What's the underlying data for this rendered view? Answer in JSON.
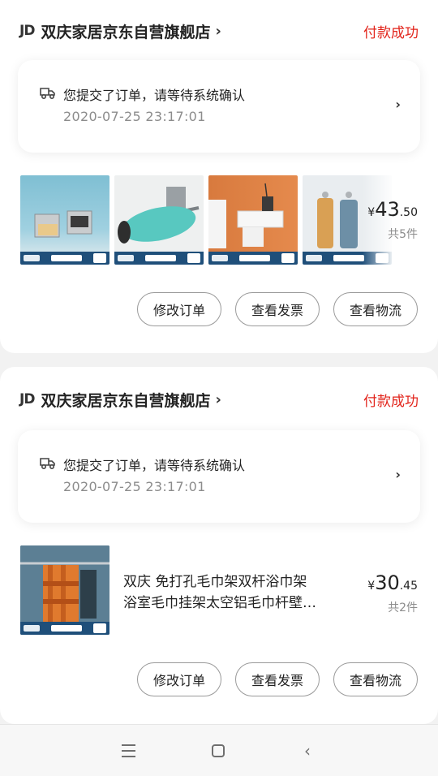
{
  "orders": [
    {
      "store": {
        "logo": "JD",
        "name": "双庆家居京东自营旗舰店",
        "arrow": "›"
      },
      "status": "付款成功",
      "notice": {
        "icon": "truck-icon",
        "title": "您提交了订单，请等待系统确认",
        "time": "2020-07-25 23:17:01",
        "chevron": "›"
      },
      "products": [
        {
          "icon": "soap-holder-image"
        },
        {
          "icon": "paper-towel-holder-image"
        },
        {
          "icon": "toilet-paper-shelf-image"
        },
        {
          "icon": "towel-hooks-image"
        }
      ],
      "price": {
        "yen": "¥",
        "int": "43",
        "dec": ".50"
      },
      "count": "共5件",
      "actions": [
        "修改订单",
        "查看发票",
        "查看物流"
      ]
    },
    {
      "store": {
        "logo": "JD",
        "name": "双庆家居京东自营旗舰店",
        "arrow": "›"
      },
      "status": "付款成功",
      "notice": {
        "icon": "truck-icon",
        "title": "您提交了订单，请等待系统确认",
        "time": "2020-07-25 23:17:01",
        "chevron": "›"
      },
      "product": {
        "icon": "towel-rack-image",
        "desc_line1": "双庆 免打孔毛巾架双杆浴巾架",
        "desc_line2": "浴室毛巾挂架太空铝毛巾杆壁…"
      },
      "price": {
        "yen": "¥",
        "int": "30",
        "dec": ".45"
      },
      "count": "共2件",
      "actions": [
        "修改订单",
        "查看发票",
        "查看物流"
      ]
    }
  ],
  "navbar": {
    "menu_icon": "menu-icon",
    "home_icon": "home-icon",
    "back_icon": "back-icon",
    "back_glyph": "‹"
  },
  "colors": {
    "status_red": "#e2231a",
    "background": "#f2f2f2",
    "strip_blue": "#1f4f7a"
  }
}
